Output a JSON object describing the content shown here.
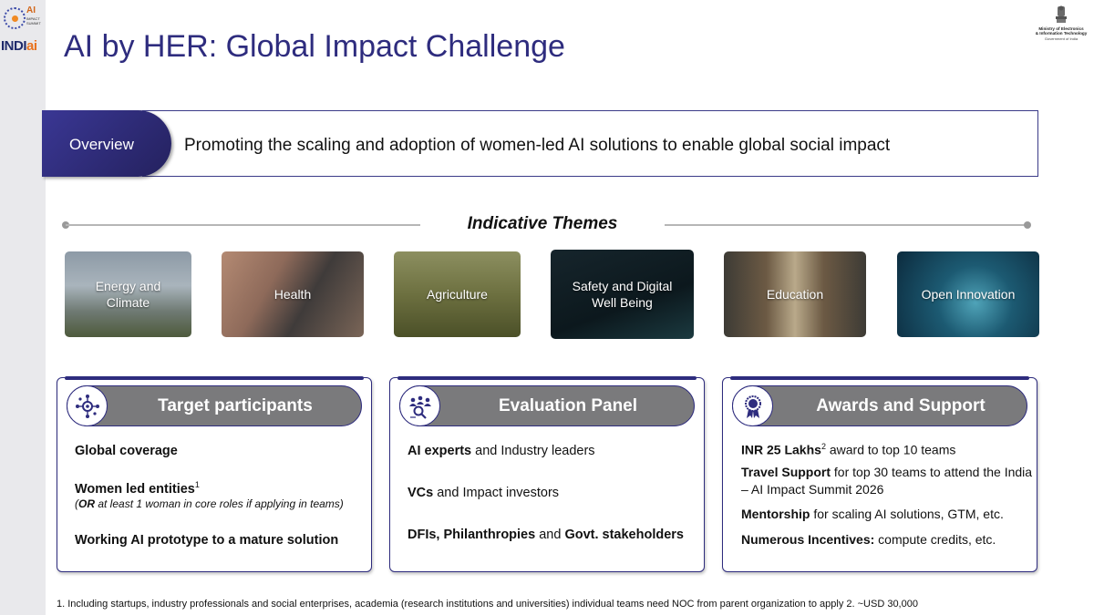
{
  "header": {
    "title": "AI by HER: Global Impact Challenge",
    "logo_top": {
      "label": "AI",
      "sub_lines": [
        "IMPACT",
        "SUMMIT"
      ]
    },
    "logo_indiai": {
      "prefix": "INDI",
      "suffix": "ai"
    },
    "ministry": {
      "line1": "Ministry of Electronics",
      "line2": "& Information Technology",
      "line3": "Government of India"
    }
  },
  "overview": {
    "tab_label": "Overview",
    "text": "Promoting the scaling and adoption of women-led AI solutions to enable global social impact"
  },
  "themes": {
    "heading": "Indicative Themes",
    "items": [
      {
        "line1": "Energy and",
        "line2": "Climate"
      },
      {
        "line1": "Health",
        "line2": ""
      },
      {
        "line1": "Agriculture",
        "line2": ""
      },
      {
        "line1": "Safety and Digital",
        "line2": "Well Being"
      },
      {
        "line1": "Education",
        "line2": ""
      },
      {
        "line1": "Open Innovation",
        "line2": ""
      }
    ]
  },
  "cards": {
    "participants": {
      "title": "Target participants",
      "icon": "network-gear-icon",
      "item1": "Global coverage",
      "item2": "Women led entities",
      "item2_sup": "1",
      "item2_sub_bold": "OR",
      "item2_sub": " at least 1 woman in core roles if applying in teams)",
      "item2_sub_open": "(",
      "item3": "Working AI prototype to a mature solution"
    },
    "panel": {
      "title": "Evaluation Panel",
      "icon": "team-search-icon",
      "item1_bold": "AI experts",
      "item1_rest": " and Industry leaders",
      "item2_bold": "VCs",
      "item2_rest": " and Impact investors",
      "item3_bold1": "DFIs, Philanthropies",
      "item3_mid": " and ",
      "item3_bold2": "Govt. stakeholders"
    },
    "awards": {
      "title": "Awards and Support",
      "icon": "award-ribbon-icon",
      "item1_bold": "INR 25 Lakhs",
      "item1_sup": "2",
      "item1_rest": " award to top 10 teams",
      "item2_bold": "Travel Support",
      "item2_rest": " for top 30 teams to attend the India – AI Impact Summit 2026",
      "item3_bold": "Mentorship",
      "item3_rest": " for scaling AI solutions, GTM, etc.",
      "item4_bold": "Numerous Incentives:",
      "item4_rest": " compute credits, etc."
    }
  },
  "footnote": "1. Including startups, industry professionals and social enterprises, academia (research institutions and universities) individual teams need NOC from parent organization to apply 2. ~USD 30,000"
}
